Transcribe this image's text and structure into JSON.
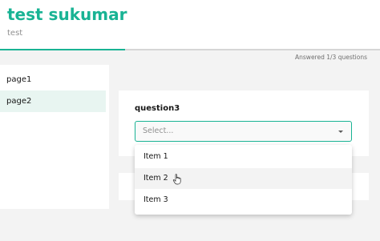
{
  "survey": {
    "title": "test sukumar",
    "description": "test"
  },
  "progress": {
    "text": "Answered 1/3 questions",
    "answered": 1,
    "total": 3,
    "fill_percent": 33,
    "accent_color": "#19b394"
  },
  "sidebar": {
    "items": [
      {
        "label": "page1",
        "active": false
      },
      {
        "label": "page2",
        "active": true
      }
    ]
  },
  "question": {
    "title": "question3",
    "placeholder": "Select...",
    "options": [
      "Item 1",
      "Item 2",
      "Item 3"
    ],
    "hovered_option": "Item 2"
  },
  "icons": {
    "dropdown_chevron": "chevron-down-icon",
    "cursor": "hand-pointer-icon"
  }
}
